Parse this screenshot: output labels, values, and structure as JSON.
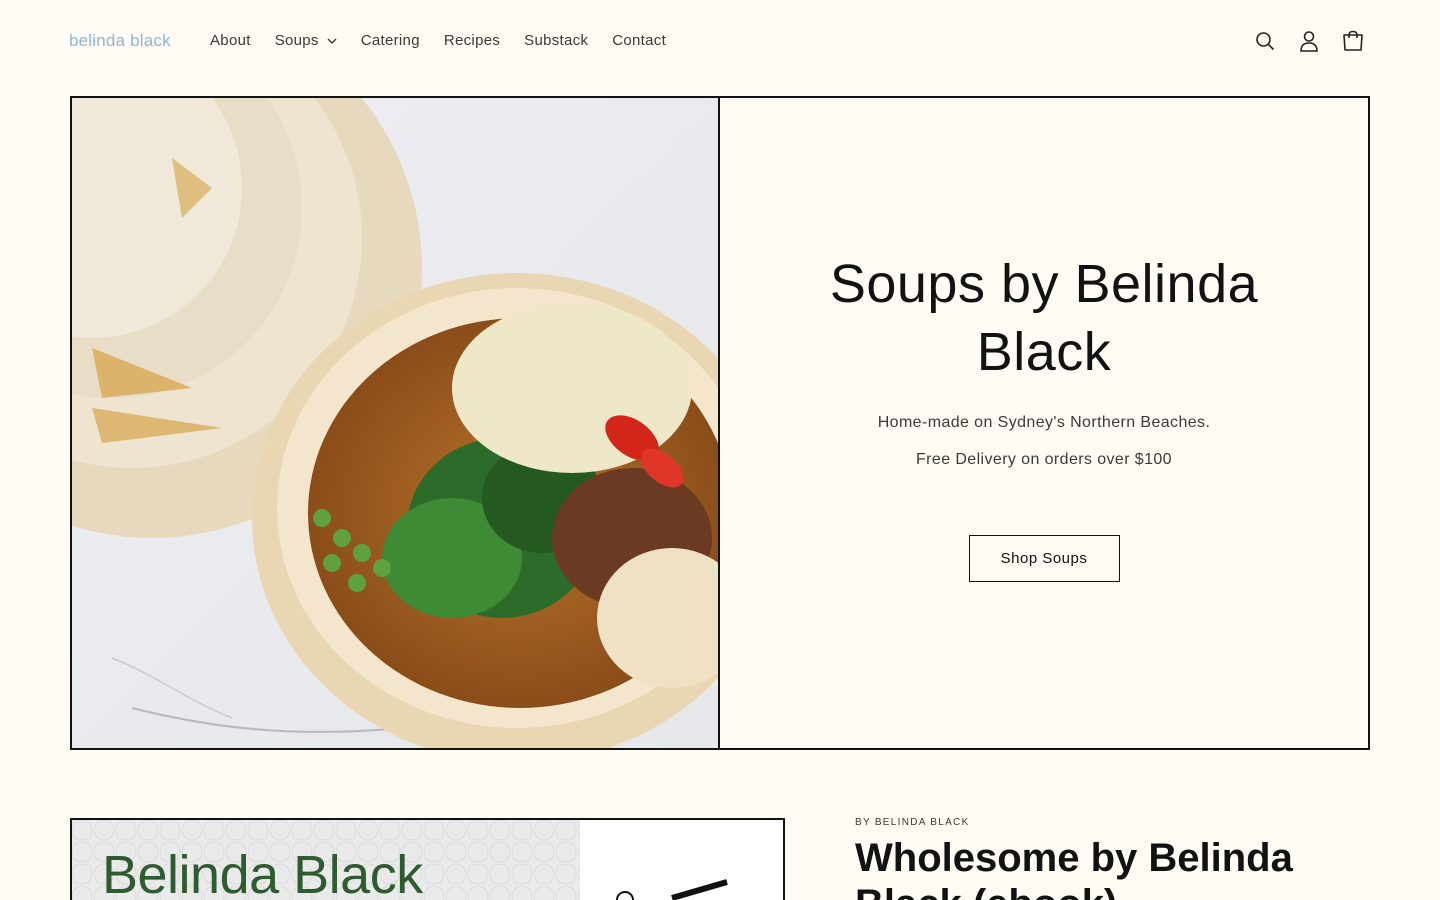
{
  "header": {
    "logo": "belinda black",
    "nav": [
      {
        "label": "About"
      },
      {
        "label": "Soups"
      },
      {
        "label": "Catering"
      },
      {
        "label": "Recipes"
      },
      {
        "label": "Substack"
      },
      {
        "label": "Contact"
      }
    ],
    "icons": [
      "search-icon",
      "account-icon",
      "cart-icon"
    ]
  },
  "hero": {
    "image": "soup-bowl-photo",
    "title": "Soups by Belinda Black",
    "line1": "Home-made on Sydney's Northern Beaches.",
    "line2": "Free Delivery on orders over $100",
    "button": "Shop Soups"
  },
  "feature": {
    "image_text": "Belinda Black",
    "kicker": "BY BELINDA BLACK",
    "title": "Wholesome by Belinda Black (ebook)"
  },
  "colors": {
    "background": "#fefcf5",
    "text": "#121212",
    "logo": "#8fb4d4",
    "brand_green": "#2e5b2f"
  }
}
